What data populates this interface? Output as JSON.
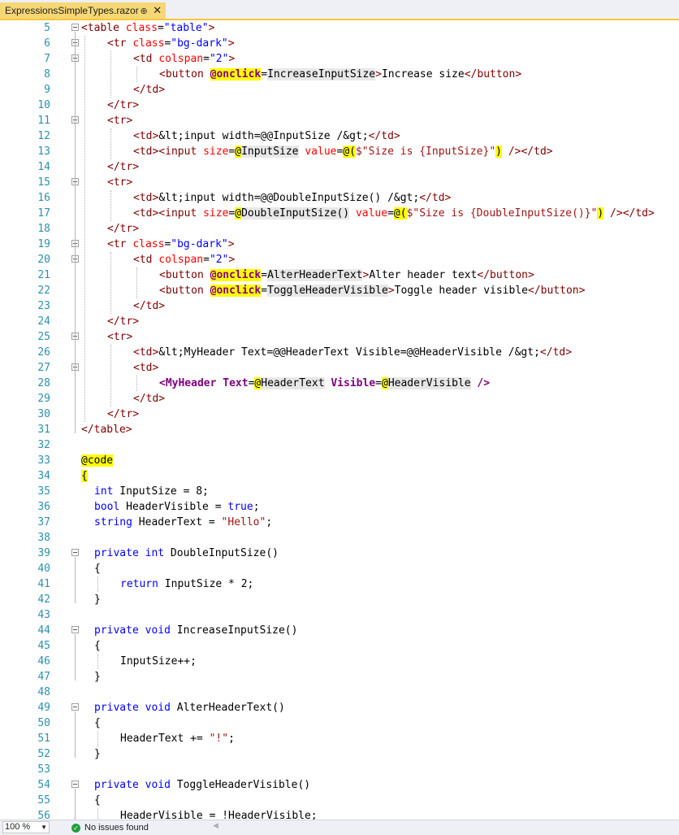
{
  "tab": {
    "title": "ExpressionsSimpleTypes.razor",
    "pin": "⊕",
    "close": "✕"
  },
  "status": {
    "zoom": "100 %",
    "issues": "No issues found",
    "scroll_arrow": "◀"
  },
  "lines": [
    {
      "n": "5",
      "fold": true,
      "segs": [
        [
          "t-tag",
          "<table "
        ],
        [
          "t-attr",
          "class"
        ],
        [
          "t-plain",
          "="
        ],
        [
          "t-str",
          "\"table\""
        ],
        [
          "t-tag",
          ">"
        ]
      ]
    },
    {
      "n": "6",
      "fold": true,
      "indent": 4,
      "segs": [
        [
          "t-tag",
          "<tr "
        ],
        [
          "t-attr",
          "class"
        ],
        [
          "t-plain",
          "="
        ],
        [
          "t-str",
          "\"bg-dark\""
        ],
        [
          "t-tag",
          ">"
        ]
      ]
    },
    {
      "n": "7",
      "fold": true,
      "indent": 8,
      "segs": [
        [
          "t-tag",
          "<td "
        ],
        [
          "t-attr",
          "colspan"
        ],
        [
          "t-plain",
          "="
        ],
        [
          "t-str",
          "\"2\""
        ],
        [
          "t-tag",
          ">"
        ]
      ]
    },
    {
      "n": "8",
      "indent": 12,
      "segs": [
        [
          "t-tag",
          "<button "
        ],
        [
          "t-dirb",
          "@onclick"
        ],
        [
          "t-plain",
          "="
        ],
        [
          "t-cbg",
          "IncreaseInputSize"
        ],
        [
          "t-tag",
          ">"
        ],
        [
          "t-plain",
          "Increase size"
        ],
        [
          "t-tag",
          "</button>"
        ]
      ]
    },
    {
      "n": "9",
      "indent": 8,
      "segs": [
        [
          "t-tag",
          "</td>"
        ]
      ]
    },
    {
      "n": "10",
      "indent": 4,
      "segs": [
        [
          "t-tag",
          "</tr>"
        ]
      ]
    },
    {
      "n": "11",
      "fold": true,
      "indent": 4,
      "segs": [
        [
          "t-tag",
          "<tr>"
        ]
      ]
    },
    {
      "n": "12",
      "indent": 8,
      "segs": [
        [
          "t-tag",
          "<td>"
        ],
        [
          "t-plain",
          "&lt;input width=@@InputSize /&gt;"
        ],
        [
          "t-tag",
          "</td>"
        ]
      ]
    },
    {
      "n": "13",
      "indent": 8,
      "segs": [
        [
          "t-tag",
          "<td><input "
        ],
        [
          "t-attr",
          "size"
        ],
        [
          "t-plain",
          "="
        ],
        [
          "t-dir",
          "@"
        ],
        [
          "t-cbg",
          "InputSize"
        ],
        [
          "t-plain",
          " "
        ],
        [
          "t-attr",
          "value"
        ],
        [
          "t-plain",
          "="
        ],
        [
          "t-dir",
          "@("
        ],
        [
          "t-cstr",
          "$\"Size is {InputSize}\""
        ],
        [
          "t-dir",
          ")"
        ],
        [
          "t-plain",
          " "
        ],
        [
          "t-tag",
          "/></td>"
        ]
      ]
    },
    {
      "n": "14",
      "indent": 4,
      "segs": [
        [
          "t-tag",
          "</tr>"
        ]
      ]
    },
    {
      "n": "15",
      "fold": true,
      "indent": 4,
      "segs": [
        [
          "t-tag",
          "<tr>"
        ]
      ]
    },
    {
      "n": "16",
      "indent": 8,
      "segs": [
        [
          "t-tag",
          "<td>"
        ],
        [
          "t-plain",
          "&lt;input width=@@DoubleInputSize() /&gt;"
        ],
        [
          "t-tag",
          "</td>"
        ]
      ]
    },
    {
      "n": "17",
      "indent": 8,
      "segs": [
        [
          "t-tag",
          "<td><input "
        ],
        [
          "t-attr",
          "size"
        ],
        [
          "t-plain",
          "="
        ],
        [
          "t-dir",
          "@"
        ],
        [
          "t-cbg",
          "DoubleInputSize()"
        ],
        [
          "t-plain",
          " "
        ],
        [
          "t-attr",
          "value"
        ],
        [
          "t-plain",
          "="
        ],
        [
          "t-dir",
          "@("
        ],
        [
          "t-cstr",
          "$\"Size is {DoubleInputSize()}\""
        ],
        [
          "t-dir",
          ")"
        ],
        [
          "t-plain",
          " "
        ],
        [
          "t-tag",
          "/></td>"
        ]
      ]
    },
    {
      "n": "18",
      "indent": 4,
      "segs": [
        [
          "t-tag",
          "</tr>"
        ]
      ]
    },
    {
      "n": "19",
      "fold": true,
      "indent": 4,
      "segs": [
        [
          "t-tag",
          "<tr "
        ],
        [
          "t-attr",
          "class"
        ],
        [
          "t-plain",
          "="
        ],
        [
          "t-str",
          "\"bg-dark\""
        ],
        [
          "t-tag",
          ">"
        ]
      ]
    },
    {
      "n": "20",
      "fold": true,
      "indent": 8,
      "segs": [
        [
          "t-tag",
          "<td "
        ],
        [
          "t-attr",
          "colspan"
        ],
        [
          "t-plain",
          "="
        ],
        [
          "t-str",
          "\"2\""
        ],
        [
          "t-tag",
          ">"
        ]
      ]
    },
    {
      "n": "21",
      "indent": 12,
      "segs": [
        [
          "t-tag",
          "<button "
        ],
        [
          "t-dirb",
          "@onclick"
        ],
        [
          "t-plain",
          "="
        ],
        [
          "t-cbg",
          "AlterHeaderText"
        ],
        [
          "t-tag",
          ">"
        ],
        [
          "t-plain",
          "Alter header text"
        ],
        [
          "t-tag",
          "</button>"
        ]
      ]
    },
    {
      "n": "22",
      "indent": 12,
      "segs": [
        [
          "t-tag",
          "<button "
        ],
        [
          "t-dirb",
          "@onclick"
        ],
        [
          "t-plain",
          "="
        ],
        [
          "t-cbg",
          "ToggleHeaderVisible"
        ],
        [
          "t-tag",
          ">"
        ],
        [
          "t-plain",
          "Toggle header visible"
        ],
        [
          "t-tag",
          "</button>"
        ]
      ]
    },
    {
      "n": "23",
      "indent": 8,
      "segs": [
        [
          "t-tag",
          "</td>"
        ]
      ]
    },
    {
      "n": "24",
      "indent": 4,
      "segs": [
        [
          "t-tag",
          "</tr>"
        ]
      ]
    },
    {
      "n": "25",
      "fold": true,
      "indent": 4,
      "segs": [
        [
          "t-tag",
          "<tr>"
        ]
      ]
    },
    {
      "n": "26",
      "indent": 8,
      "segs": [
        [
          "t-tag",
          "<td>"
        ],
        [
          "t-plain",
          "&lt;MyHeader Text=@@HeaderText Visible=@@HeaderVisible /&gt;"
        ],
        [
          "t-tag",
          "</td>"
        ]
      ]
    },
    {
      "n": "27",
      "fold": true,
      "indent": 8,
      "segs": [
        [
          "t-tag",
          "<td>"
        ]
      ]
    },
    {
      "n": "28",
      "indent": 12,
      "segs": [
        [
          "t-comp",
          "<MyHeader "
        ],
        [
          "t-comp",
          "Text"
        ],
        [
          "t-plain",
          "="
        ],
        [
          "t-dir",
          "@"
        ],
        [
          "t-cbg",
          "HeaderText"
        ],
        [
          "t-plain",
          " "
        ],
        [
          "t-comp",
          "Visible"
        ],
        [
          "t-plain",
          "="
        ],
        [
          "t-dir",
          "@"
        ],
        [
          "t-cbg",
          "HeaderVisible"
        ],
        [
          "t-plain",
          " "
        ],
        [
          "t-comp",
          "/>"
        ]
      ]
    },
    {
      "n": "29",
      "indent": 8,
      "segs": [
        [
          "t-tag",
          "</td>"
        ]
      ]
    },
    {
      "n": "30",
      "indent": 4,
      "segs": [
        [
          "t-tag",
          "</tr>"
        ]
      ]
    },
    {
      "n": "31",
      "segs": [
        [
          "t-tag",
          "</table>"
        ]
      ]
    },
    {
      "n": "32",
      "segs": []
    },
    {
      "n": "33",
      "segs": [
        [
          "t-dir",
          "@code"
        ]
      ]
    },
    {
      "n": "34",
      "segs": [
        [
          "t-dir",
          "{"
        ]
      ]
    },
    {
      "n": "35",
      "indent": 2,
      "segs": [
        [
          "t-kw",
          "int"
        ],
        [
          "t-plain",
          " InputSize = 8;"
        ]
      ]
    },
    {
      "n": "36",
      "indent": 2,
      "segs": [
        [
          "t-kw",
          "bool"
        ],
        [
          "t-plain",
          " HeaderVisible = "
        ],
        [
          "t-kw",
          "true"
        ],
        [
          "t-plain",
          ";"
        ]
      ]
    },
    {
      "n": "37",
      "indent": 2,
      "segs": [
        [
          "t-kw",
          "string"
        ],
        [
          "t-plain",
          " HeaderText = "
        ],
        [
          "t-cstr",
          "\"Hello\""
        ],
        [
          "t-plain",
          ";"
        ]
      ]
    },
    {
      "n": "38",
      "segs": []
    },
    {
      "n": "39",
      "fold": true,
      "indent": 2,
      "segs": [
        [
          "t-kw",
          "private int"
        ],
        [
          "t-plain",
          " DoubleInputSize()"
        ]
      ]
    },
    {
      "n": "40",
      "indent": 2,
      "segs": [
        [
          "t-plain",
          "{"
        ]
      ]
    },
    {
      "n": "41",
      "indent": 6,
      "segs": [
        [
          "t-kw",
          "return"
        ],
        [
          "t-plain",
          " InputSize * 2;"
        ]
      ]
    },
    {
      "n": "42",
      "indent": 2,
      "segs": [
        [
          "t-plain",
          "}"
        ]
      ]
    },
    {
      "n": "43",
      "segs": []
    },
    {
      "n": "44",
      "fold": true,
      "indent": 2,
      "segs": [
        [
          "t-kw",
          "private void"
        ],
        [
          "t-plain",
          " IncreaseInputSize()"
        ]
      ]
    },
    {
      "n": "45",
      "indent": 2,
      "segs": [
        [
          "t-plain",
          "{"
        ]
      ]
    },
    {
      "n": "46",
      "indent": 6,
      "segs": [
        [
          "t-plain",
          "InputSize++;"
        ]
      ]
    },
    {
      "n": "47",
      "indent": 2,
      "segs": [
        [
          "t-plain",
          "}"
        ]
      ]
    },
    {
      "n": "48",
      "segs": []
    },
    {
      "n": "49",
      "fold": true,
      "indent": 2,
      "segs": [
        [
          "t-kw",
          "private void"
        ],
        [
          "t-plain",
          " AlterHeaderText()"
        ]
      ]
    },
    {
      "n": "50",
      "indent": 2,
      "segs": [
        [
          "t-plain",
          "{"
        ]
      ]
    },
    {
      "n": "51",
      "indent": 6,
      "segs": [
        [
          "t-plain",
          "HeaderText += "
        ],
        [
          "t-cstr",
          "\"!\""
        ],
        [
          "t-plain",
          ";"
        ]
      ]
    },
    {
      "n": "52",
      "indent": 2,
      "segs": [
        [
          "t-plain",
          "}"
        ]
      ]
    },
    {
      "n": "53",
      "segs": []
    },
    {
      "n": "54",
      "fold": true,
      "indent": 2,
      "segs": [
        [
          "t-kw",
          "private void"
        ],
        [
          "t-plain",
          " ToggleHeaderVisible()"
        ]
      ]
    },
    {
      "n": "55",
      "indent": 2,
      "segs": [
        [
          "t-plain",
          "{"
        ]
      ]
    },
    {
      "n": "56",
      "indent": 6,
      "segs": [
        [
          "t-plain",
          "HeaderVisible = !HeaderVisible;"
        ]
      ]
    }
  ]
}
